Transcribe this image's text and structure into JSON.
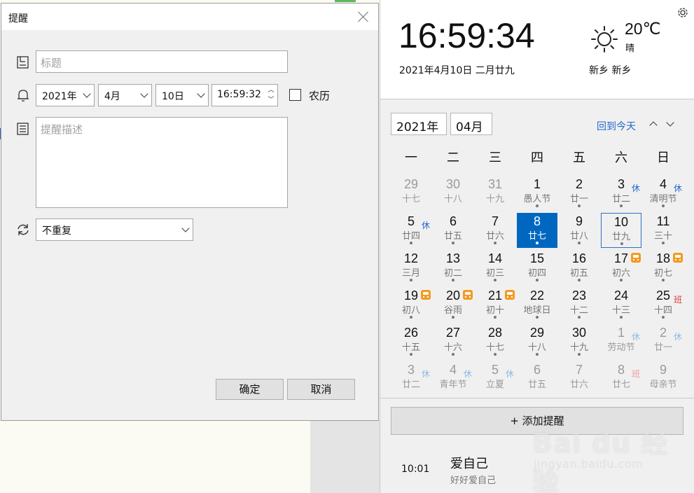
{
  "dialog": {
    "title": "提醒",
    "title_placeholder": "标题",
    "year": "2021年",
    "month": "4月",
    "day": "10日",
    "time": "16:59:32",
    "lunar_label": "农历",
    "description_placeholder": "提醒描述",
    "repeat": "不重复",
    "ok_label": "确定",
    "cancel_label": "取消"
  },
  "clock": {
    "time": "16:59:34",
    "date": "2021年4月10日 二月廿九",
    "temperature": "20℃",
    "weather": "晴",
    "city": "新乡 新乡"
  },
  "calendar": {
    "year": "2021年",
    "month": "04月",
    "today_link": "回到今天",
    "weekdays": [
      "一",
      "二",
      "三",
      "四",
      "五",
      "六",
      "日"
    ],
    "cells": [
      {
        "d": "29",
        "l": "十七",
        "other": true
      },
      {
        "d": "30",
        "l": "十八",
        "other": true
      },
      {
        "d": "31",
        "l": "十九",
        "other": true
      },
      {
        "d": "1",
        "l": "愚人节"
      },
      {
        "d": "2",
        "l": "廿一"
      },
      {
        "d": "3",
        "l": "廿二",
        "badge": "休"
      },
      {
        "d": "4",
        "l": "清明节",
        "badge": "休"
      },
      {
        "d": "5",
        "l": "廿四",
        "badge": "休"
      },
      {
        "d": "6",
        "l": "廿五"
      },
      {
        "d": "7",
        "l": "廿六"
      },
      {
        "d": "8",
        "l": "廿七",
        "today": true
      },
      {
        "d": "9",
        "l": "廿八"
      },
      {
        "d": "10",
        "l": "廿九",
        "hover": true
      },
      {
        "d": "11",
        "l": "三十"
      },
      {
        "d": "12",
        "l": "三月"
      },
      {
        "d": "13",
        "l": "初二"
      },
      {
        "d": "14",
        "l": "初三"
      },
      {
        "d": "15",
        "l": "初四"
      },
      {
        "d": "16",
        "l": "初五"
      },
      {
        "d": "17",
        "l": "初六",
        "train": true
      },
      {
        "d": "18",
        "l": "初七",
        "train": true
      },
      {
        "d": "19",
        "l": "初八",
        "train": true
      },
      {
        "d": "20",
        "l": "谷雨",
        "train": true
      },
      {
        "d": "21",
        "l": "初十",
        "train": true
      },
      {
        "d": "22",
        "l": "地球日"
      },
      {
        "d": "23",
        "l": "十二"
      },
      {
        "d": "24",
        "l": "十三"
      },
      {
        "d": "25",
        "l": "十四",
        "badge": "班"
      },
      {
        "d": "26",
        "l": "十五"
      },
      {
        "d": "27",
        "l": "十六"
      },
      {
        "d": "28",
        "l": "十七"
      },
      {
        "d": "29",
        "l": "十八"
      },
      {
        "d": "30",
        "l": "十九"
      },
      {
        "d": "1",
        "l": "劳动节",
        "other": true,
        "badge": "休"
      },
      {
        "d": "2",
        "l": "廿一",
        "other": true,
        "badge": "休"
      },
      {
        "d": "3",
        "l": "廿二",
        "other": true,
        "badge": "休"
      },
      {
        "d": "4",
        "l": "青年节",
        "other": true,
        "badge": "休"
      },
      {
        "d": "5",
        "l": "立夏",
        "other": true,
        "badge": "休"
      },
      {
        "d": "6",
        "l": "廿五",
        "other": true
      },
      {
        "d": "7",
        "l": "廿六",
        "other": true
      },
      {
        "d": "8",
        "l": "廿七",
        "other": true,
        "badge": "班"
      },
      {
        "d": "9",
        "l": "母亲节",
        "other": true
      }
    ]
  },
  "reminders": {
    "add_label": "+ 添加提醒",
    "items": [
      {
        "time": "10:01",
        "title": "爱自己",
        "subtitle": "好好爱自己"
      }
    ]
  },
  "watermark": {
    "main": "Bai du 经验",
    "sub": "jingyan.baidu.com"
  },
  "colors": {
    "accent": "#0067c0",
    "link": "#1e68c8",
    "holiday_badge": "#1e68c8",
    "workday_badge": "#e0393e",
    "train_icon": "#f39a1e"
  }
}
